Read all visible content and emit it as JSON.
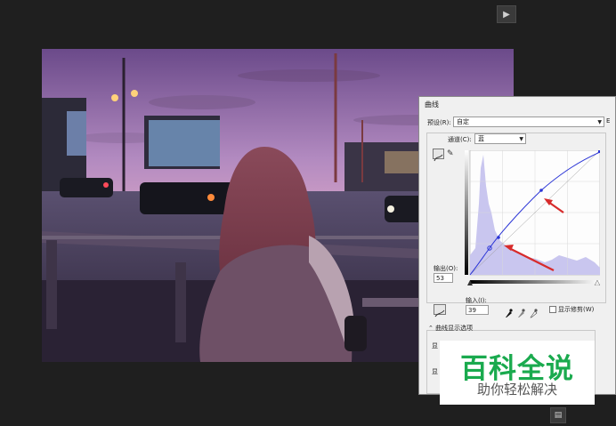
{
  "toolbar": {
    "top_button_icon": "play-icon",
    "bottom_button_icon": "panel-icon"
  },
  "dialog": {
    "title": "曲线",
    "preset_label": "预设(R):",
    "preset_value": "自定",
    "preset_menu": "E",
    "channel_label": "通道(C):",
    "channel_value": "蓝",
    "output_label": "输出(O):",
    "output_value": "53",
    "input_label": "输入(I):",
    "input_value": "39",
    "show_clipping_label": "显示修剪(W)",
    "curve_options_label": "曲线显示选项",
    "opt_a": "显",
    "opt_b": "显"
  },
  "colors": {
    "curve": "#2b35d6",
    "histogram": "#c9c6ef",
    "arrow": "#d72b2b",
    "watermark_green": "#1aaa4e"
  },
  "watermark": {
    "main": "百科全说",
    "sub": "助你轻松解决"
  }
}
